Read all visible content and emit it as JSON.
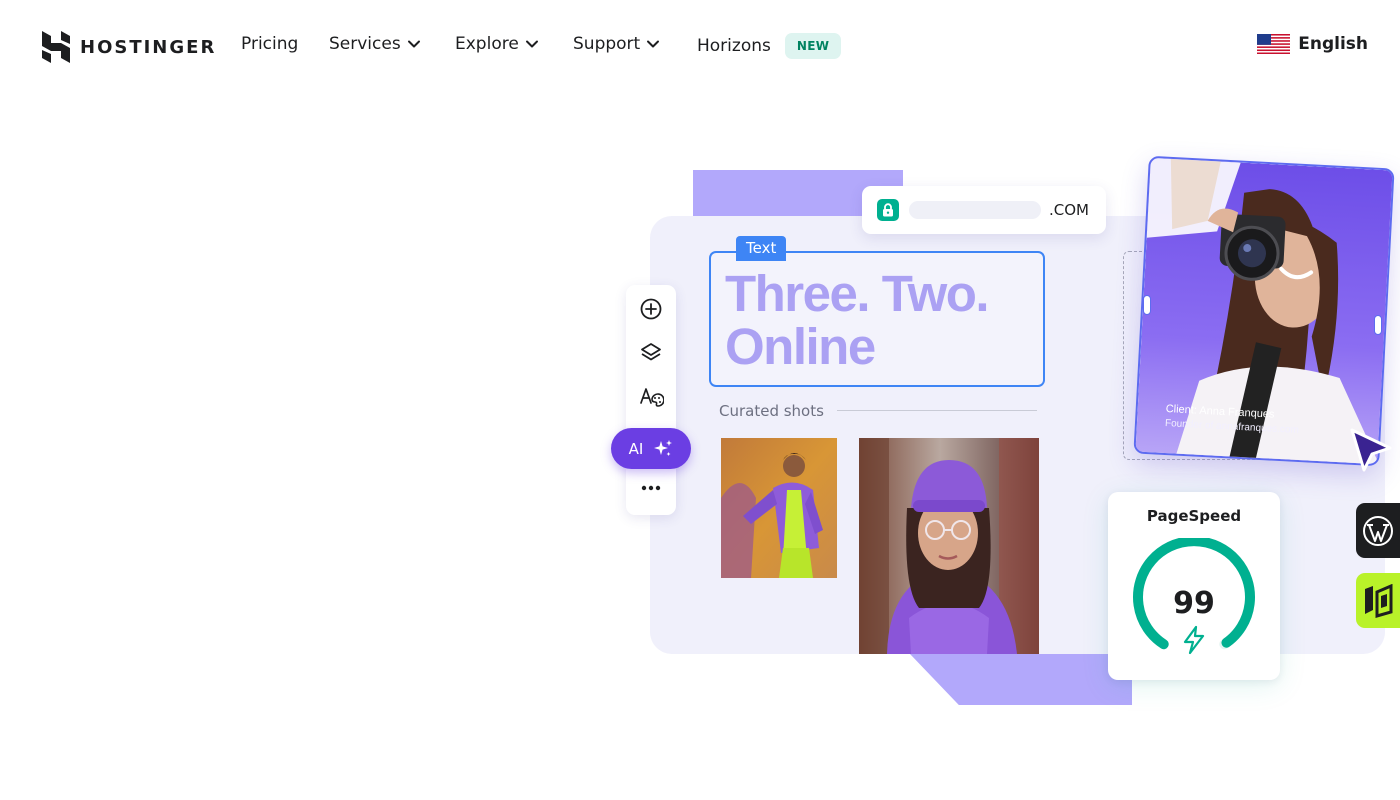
{
  "nav": {
    "brand": "HOSTINGER",
    "pricing": "Pricing",
    "services": "Services",
    "explore": "Explore",
    "support": "Support",
    "horizons": "Horizons",
    "horizons_badge": "NEW",
    "language": "English"
  },
  "hero": {
    "url_tld": ".COM",
    "text_tag": "Text",
    "headline_line1": "Three. Two.",
    "headline_line2": "Online",
    "curated_label": "Curated shots",
    "ai_label": "AI",
    "portrait_client": "Client: Anna Franques",
    "portrait_founder": "Founder of annafranques.com",
    "pagespeed_title": "PageSpeed",
    "pagespeed_score": "99",
    "pagespeed_fraction": 0.99
  },
  "icons": {
    "logo": "hostinger-logo-icon",
    "chevron": "chevron-down-icon",
    "flag": "us-flag-icon",
    "lock": "lock-icon",
    "add": "plus-circle-icon",
    "layers": "layers-icon",
    "typography": "typography-palette-icon",
    "sparkle": "sparkle-icon",
    "more": "more-horizontal-icon",
    "cursor": "cursor-pointer-icon",
    "bolt": "lightning-bolt-icon",
    "wordpress": "wordpress-icon",
    "builder": "website-builder-icon"
  },
  "colors": {
    "brand_purple": "#673de6",
    "accent_lilac": "#b2a8fb",
    "headline": "#aba1f3",
    "selection_blue": "#3e85f5",
    "success_green": "#00b090",
    "badge_bg": "#def4f0",
    "badge_text": "#008361",
    "lime": "#b9f229"
  }
}
